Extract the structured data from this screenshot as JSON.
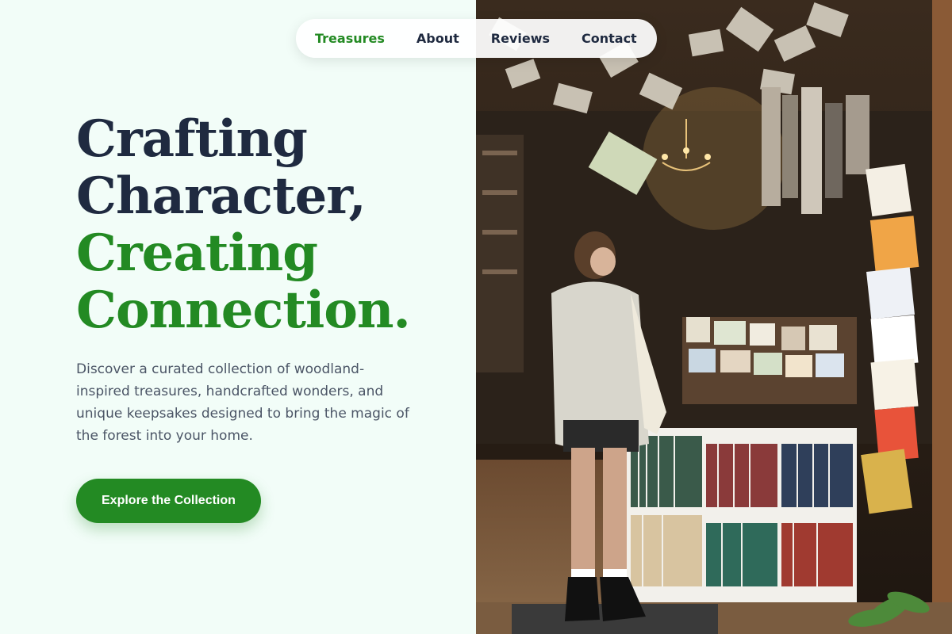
{
  "nav": {
    "items": [
      {
        "label": "Treasures",
        "active": true
      },
      {
        "label": "About",
        "active": false
      },
      {
        "label": "Reviews",
        "active": false
      },
      {
        "label": "Contact",
        "active": false
      }
    ]
  },
  "hero": {
    "headline_line1": "Crafting",
    "headline_line2": "Character,",
    "headline_line3": "Creating",
    "headline_line4": "Connection.",
    "description": "Discover a curated collection of woodland-inspired treasures, handcrafted wonders, and unique keepsakes designed to bring the magic of the forest into your home.",
    "cta_label": "Explore the Collection"
  },
  "colors": {
    "accent": "#238a23",
    "heading": "#1f2a40",
    "body_text": "#4b5566",
    "background": "#f2fdf8"
  }
}
